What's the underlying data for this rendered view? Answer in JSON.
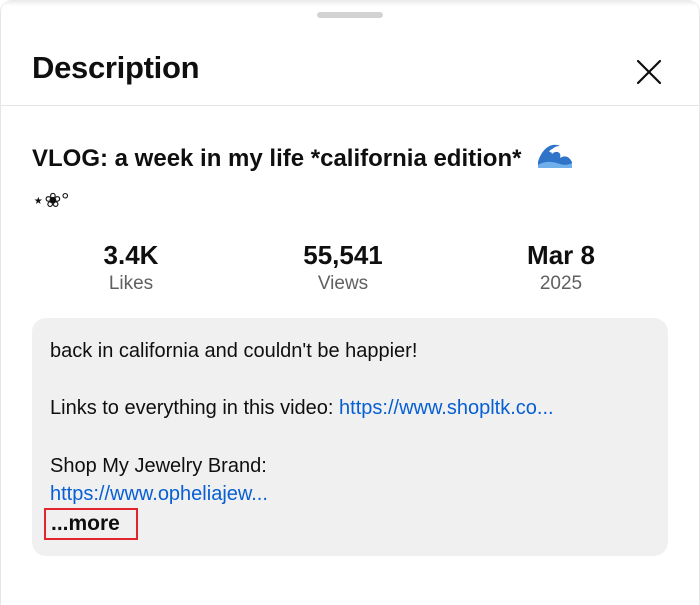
{
  "header": {
    "title": "Description"
  },
  "video": {
    "title_line1": "VLOG: a week in my life  *california edition*",
    "title_line2": "⋆❀°"
  },
  "stats": {
    "likes": {
      "value": "3.4K",
      "label": "Likes"
    },
    "views": {
      "value": "55,541",
      "label": "Views"
    },
    "date": {
      "value": "Mar 8",
      "label": "2025"
    }
  },
  "description": {
    "line1": "back in california and couldn't be happier!",
    "links_prefix": "Links to everything in this video: ",
    "links_url": "https://www.shopltk.co...",
    "jewelry_label": "Shop My Jewelry Brand:",
    "jewelry_url": "https://www.opheliajew...",
    "more_label": "...more"
  },
  "icons": {
    "close": "close-icon",
    "wave": "water-wave-emoji"
  },
  "colors": {
    "link": "#065fd4",
    "highlight_border": "#e0262c",
    "description_bg": "#f0f0f0"
  }
}
